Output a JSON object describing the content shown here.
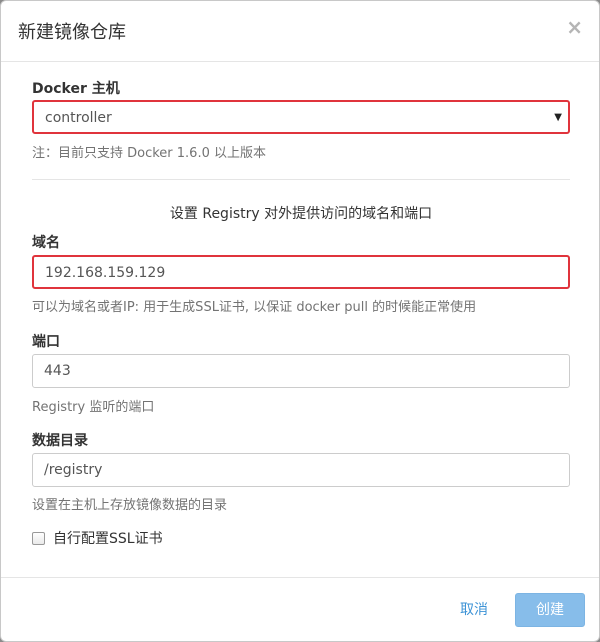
{
  "dialog": {
    "title": "新建镜像仓库",
    "close_label": "×"
  },
  "docker_host": {
    "label": "Docker 主机",
    "selected": "controller",
    "help": "注：目前只支持 Docker 1.6.0 以上版本"
  },
  "registry_section": {
    "title": "设置 Registry 对外提供访问的域名和端口"
  },
  "domain": {
    "label": "域名",
    "value": "192.168.159.129",
    "help": "可以为域名或者IP: 用于生成SSL证书, 以保证 docker pull 的时候能正常使用"
  },
  "port": {
    "label": "端口",
    "value": "443",
    "help": "Registry 监听的端口"
  },
  "data_dir": {
    "label": "数据目录",
    "value": "/registry",
    "help": "设置在主机上存放镜像数据的目录"
  },
  "ssl": {
    "checkbox_label": "自行配置SSL证书",
    "checked": false
  },
  "footer": {
    "cancel_label": "取消",
    "create_label": "创建"
  },
  "colors": {
    "highlight_border": "#e0343c",
    "primary_button": "#87bdea",
    "link": "#3d93d6"
  }
}
